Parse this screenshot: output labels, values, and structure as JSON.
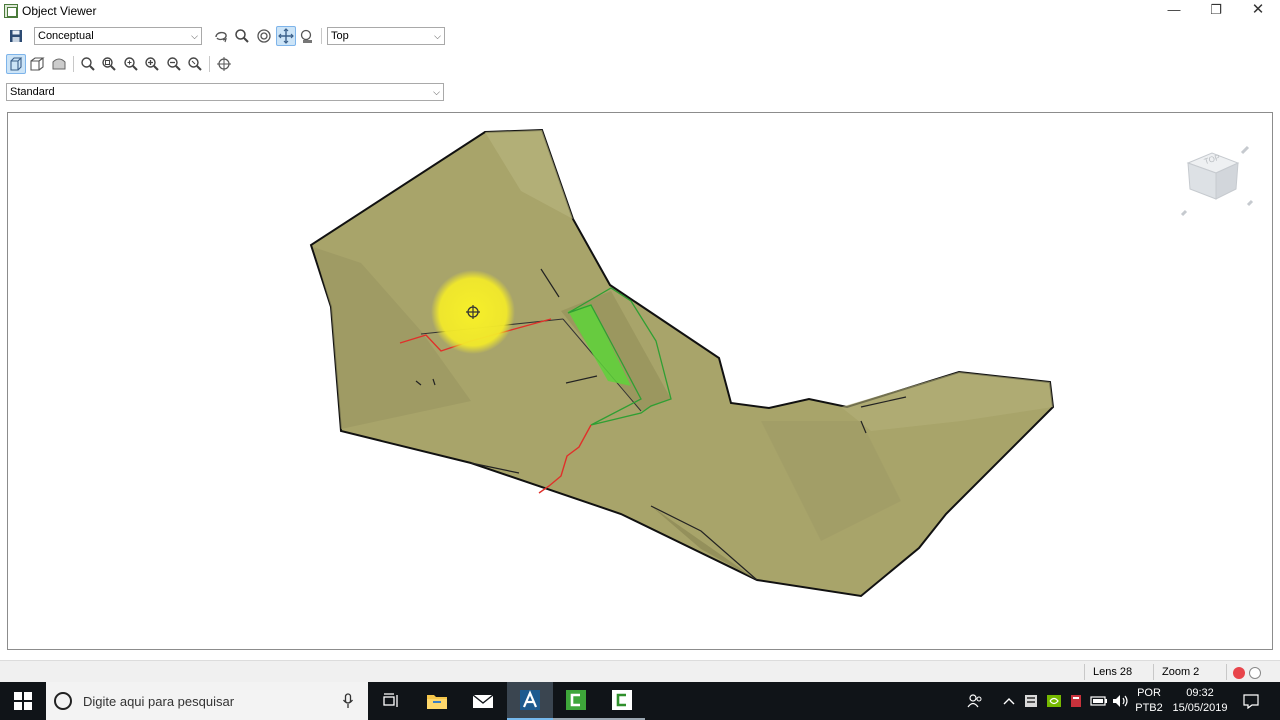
{
  "window": {
    "title": "Object Viewer",
    "minimize_glyph": "—",
    "maximize_glyph": "❐",
    "close_glyph": "✕"
  },
  "toolbar": {
    "visual_style": "Conceptual",
    "view": "Top",
    "named_view": "Standard",
    "combo_arrow": "⌵"
  },
  "icons": {
    "row1": [
      "save-icon",
      "orbit-icon",
      "zoom-icon",
      "zoom-extents-icon",
      "pan-icon",
      "camera-icon"
    ],
    "row2": [
      "perspective-icon",
      "parallel-icon",
      "shaded-icon",
      "zoom-in-icon",
      "zoom-window-icon",
      "zoom-all-icon",
      "zoom-plus-icon",
      "zoom-minus-icon",
      "zoom-previous-icon",
      "target-icon"
    ],
    "viewcube": "viewcube-icon"
  },
  "viewcube": {
    "label": "TOP"
  },
  "status": {
    "lens": "Lens 28",
    "zoom": "Zoom 2"
  },
  "taskbar": {
    "search_placeholder": "Digite aqui para pesquisar",
    "language_top": "POR",
    "language_bottom": "PTB2",
    "time": "09:32",
    "date": "15/05/2019"
  },
  "colors": {
    "surface": "#a8a46a",
    "surface_light": "#b5b27c",
    "cursor_highlight": "#f6ef2a",
    "red_line": "#e0302a",
    "green_line": "#2f9f33",
    "green_fill": "#5ed33a",
    "taskbar": "#101418"
  }
}
